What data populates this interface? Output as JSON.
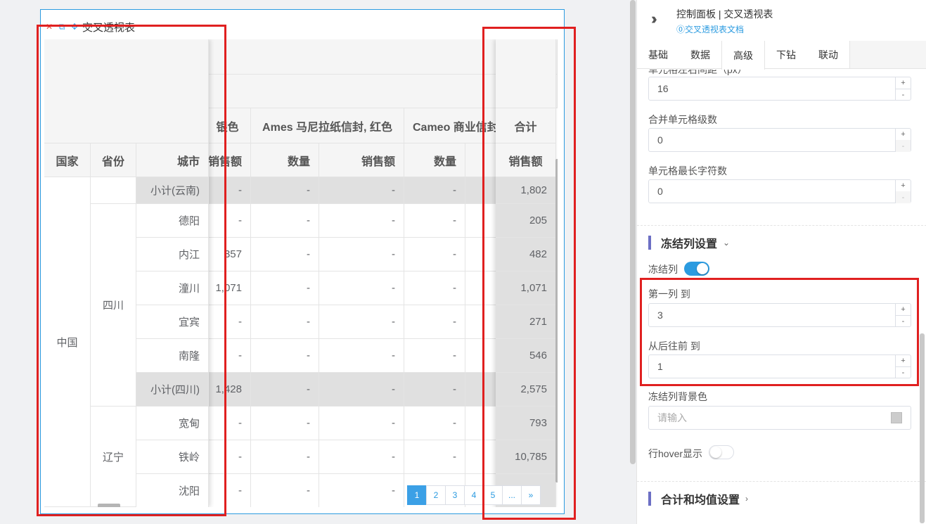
{
  "widget": {
    "title": "交叉透视表",
    "header_cols": {
      "partial_label": "银色",
      "col2": "Ames 马尼拉纸信封, 红色",
      "col3": "Cameo 商业信封",
      "total": "合计"
    },
    "subheaders": {
      "country": "国家",
      "province": "省份",
      "city": "城市",
      "sales": "销售额",
      "qty": "数量",
      "sales2": "销售额",
      "qty2": "数量",
      "total_sales": "销售额"
    },
    "rows": [
      {
        "country": "",
        "province": "",
        "city": "小计(云南)",
        "c1": "-",
        "c2": "-",
        "c3": "-",
        "c4": "-",
        "total": "1,802",
        "subtotal": true
      },
      {
        "country": "",
        "province": "",
        "city": "德阳",
        "c1": "-",
        "c2": "-",
        "c3": "-",
        "c4": "-",
        "total": "205",
        "subtotal": false
      },
      {
        "country": "",
        "province": "",
        "city": "内江",
        "c1": "357",
        "c2": "-",
        "c3": "-",
        "c4": "-",
        "total": "482",
        "subtotal": false
      },
      {
        "country": "",
        "province": "",
        "city": "潼川",
        "c1": "1,071",
        "c2": "-",
        "c3": "-",
        "c4": "-",
        "total": "1,071",
        "subtotal": false
      },
      {
        "country": "",
        "province": "",
        "city": "宜宾",
        "c1": "-",
        "c2": "-",
        "c3": "-",
        "c4": "-",
        "total": "271",
        "subtotal": false
      },
      {
        "country": "",
        "province": "",
        "city": "南隆",
        "c1": "-",
        "c2": "-",
        "c3": "-",
        "c4": "-",
        "total": "546",
        "subtotal": false
      },
      {
        "country": "",
        "province": "",
        "city": "小计(四川)",
        "c1": "1,428",
        "c2": "-",
        "c3": "-",
        "c4": "-",
        "total": "2,575",
        "subtotal": true
      },
      {
        "country": "",
        "province": "",
        "city": "宽甸",
        "c1": "-",
        "c2": "-",
        "c3": "-",
        "c4": "-",
        "total": "793",
        "subtotal": false
      },
      {
        "country": "",
        "province": "",
        "city": "铁岭",
        "c1": "-",
        "c2": "-",
        "c3": "-",
        "c4": "-",
        "total": "10,785",
        "subtotal": false
      },
      {
        "country": "",
        "province": "",
        "city": "沈阳",
        "c1": "-",
        "c2": "-",
        "c3": "-",
        "c4": "",
        "total": "",
        "subtotal": false
      }
    ],
    "country_cell": "中国",
    "province_sichuan": "四川",
    "province_liaoning": "辽宁",
    "pagination": [
      "1",
      "2",
      "3",
      "4",
      "5",
      "...",
      "»"
    ]
  },
  "panel": {
    "title": "控制面板 | 交叉透视表",
    "doc_link": "⓪交叉透视表文档",
    "tabs": [
      "基础",
      "数据",
      "高级",
      "下钻",
      "联动"
    ],
    "active_tab": "高级",
    "cut_label": "单元格左右间距（px）",
    "padding_value": "16",
    "merge_label": "合并单元格级数",
    "merge_value": "0",
    "maxchars_label": "单元格最长字符数",
    "maxchars_value": "0",
    "freeze_section": "冻结列设置",
    "freeze_toggle_label": "冻结列",
    "first_col_label": "第一列 到",
    "first_col_value": "3",
    "back_label": "从后往前 到",
    "back_value": "1",
    "bg_label": "冻结列背景色",
    "bg_placeholder": "请输入",
    "hover_label": "行hover显示",
    "total_section": "合计和均值设置"
  }
}
